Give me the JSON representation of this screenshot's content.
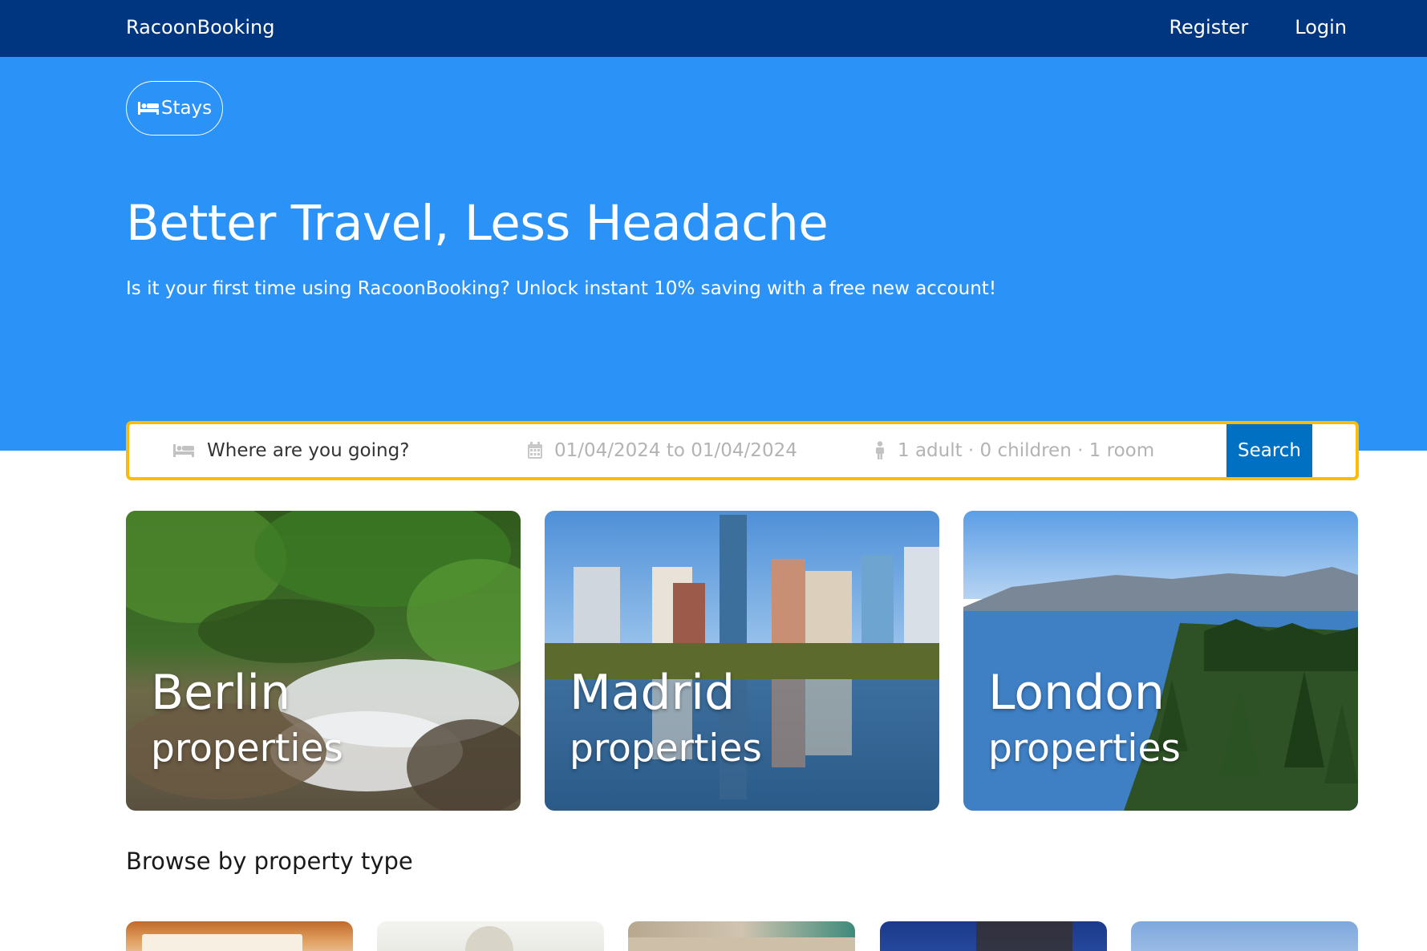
{
  "nav": {
    "brand": "RacoonBooking",
    "register": "Register",
    "login": "Login"
  },
  "hero": {
    "stays_label": "Stays",
    "title": "Better Travel, Less Headache",
    "subtitle": "Is it your first time using RacoonBooking? Unlock instant 10% saving with a free new account!"
  },
  "search": {
    "destination_placeholder": "Where are you going?",
    "dates": "01/04/2024 to 01/04/2024",
    "guests": "1 adult · 0 children · 1 room",
    "button": "Search"
  },
  "cities": [
    {
      "name": "Berlin",
      "sub": "properties"
    },
    {
      "name": "Madrid",
      "sub": "properties"
    },
    {
      "name": "London",
      "sub": "properties"
    }
  ],
  "browse": {
    "title": "Browse by property type"
  },
  "colors": {
    "navbar": "#003580",
    "hero": "#2b92f7",
    "search_border": "#febb02",
    "search_button": "#0071c2"
  }
}
